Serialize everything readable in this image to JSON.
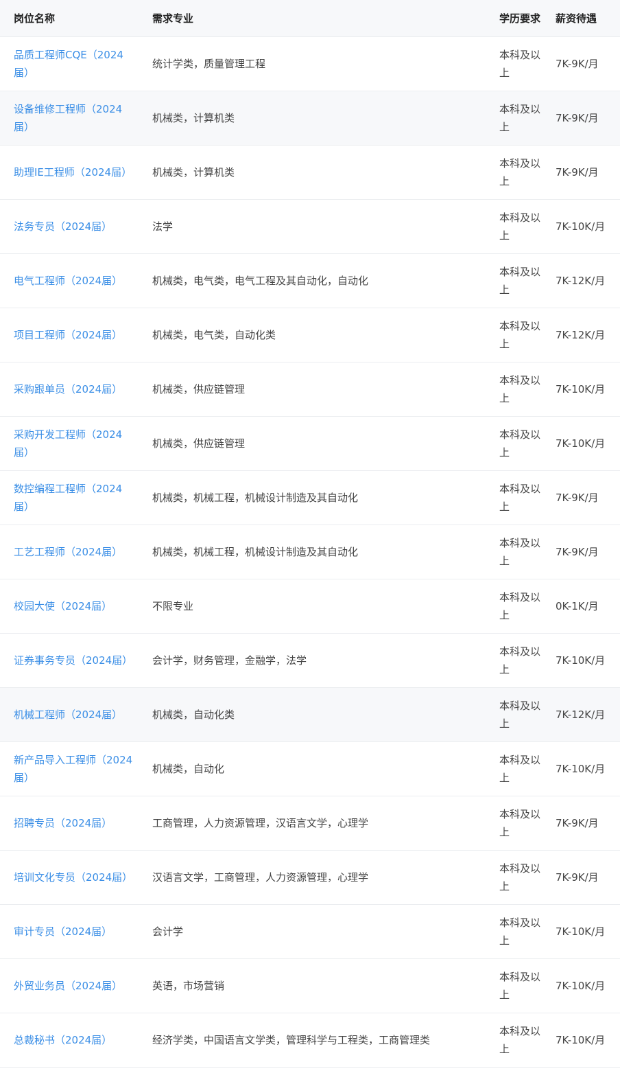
{
  "header": {
    "title": "岗位名称",
    "major": "需求专业",
    "education": "学历要求",
    "salary": "薪资待遇"
  },
  "rows": [
    {
      "title": "品质工程师CQE（2024届）",
      "major": "统计学类，质量管理工程",
      "education": "本科及以上",
      "salary": "7K-9K/月"
    },
    {
      "title": "设备维修工程师（2024届）",
      "major": "机械类，计算机类",
      "education": "本科及以上",
      "salary": "7K-9K/月"
    },
    {
      "title": "助理IE工程师（2024届）",
      "major": "机械类，计算机类",
      "education": "本科及以上",
      "salary": "7K-9K/月"
    },
    {
      "title": "法务专员（2024届）",
      "major": "法学",
      "education": "本科及以上",
      "salary": "7K-10K/月"
    },
    {
      "title": "电气工程师（2024届）",
      "major": "机械类，电气类，电气工程及其自动化，自动化",
      "education": "本科及以上",
      "salary": "7K-12K/月"
    },
    {
      "title": "项目工程师（2024届）",
      "major": "机械类，电气类，自动化类",
      "education": "本科及以上",
      "salary": "7K-12K/月"
    },
    {
      "title": "采购跟单员（2024届）",
      "major": "机械类，供应链管理",
      "education": "本科及以上",
      "salary": "7K-10K/月"
    },
    {
      "title": "采购开发工程师（2024届）",
      "major": "机械类，供应链管理",
      "education": "本科及以上",
      "salary": "7K-10K/月"
    },
    {
      "title": "数控编程工程师（2024届）",
      "major": "机械类，机械工程，机械设计制造及其自动化",
      "education": "本科及以上",
      "salary": "7K-9K/月"
    },
    {
      "title": "工艺工程师（2024届）",
      "major": "机械类，机械工程，机械设计制造及其自动化",
      "education": "本科及以上",
      "salary": "7K-9K/月"
    },
    {
      "title": "校园大使（2024届）",
      "major": "不限专业",
      "education": "本科及以上",
      "salary": "0K-1K/月"
    },
    {
      "title": "证券事务专员（2024届）",
      "major": "会计学，财务管理，金融学，法学",
      "education": "本科及以上",
      "salary": "7K-10K/月"
    },
    {
      "title": "机械工程师（2024届）",
      "major": "机械类，自动化类",
      "education": "本科及以上",
      "salary": "7K-12K/月"
    },
    {
      "title": "新产品导入工程师（2024届）",
      "major": "机械类，自动化",
      "education": "本科及以上",
      "salary": "7K-10K/月"
    },
    {
      "title": "招聘专员（2024届）",
      "major": "工商管理，人力资源管理，汉语言文学，心理学",
      "education": "本科及以上",
      "salary": "7K-9K/月"
    },
    {
      "title": "培训文化专员（2024届）",
      "major": "汉语言文学，工商管理，人力资源管理，心理学",
      "education": "本科及以上",
      "salary": "7K-9K/月"
    },
    {
      "title": "审计专员（2024届）",
      "major": "会计学",
      "education": "本科及以上",
      "salary": "7K-10K/月"
    },
    {
      "title": "外贸业务员（2024届）",
      "major": "英语，市场营销",
      "education": "本科及以上",
      "salary": "7K-10K/月"
    },
    {
      "title": "总裁秘书（2024届）",
      "major": "经济学类，中国语言文学类，管理科学与工程类，工商管理类",
      "education": "本科及以上",
      "salary": "7K-10K/月"
    }
  ],
  "colors": {
    "link": "#3a8ee6",
    "header_bg": "#f7f8fa",
    "highlight_row_bg": "#f7f8fa",
    "border": "#ebedf0"
  },
  "highlighted_rows": [
    1,
    12
  ]
}
